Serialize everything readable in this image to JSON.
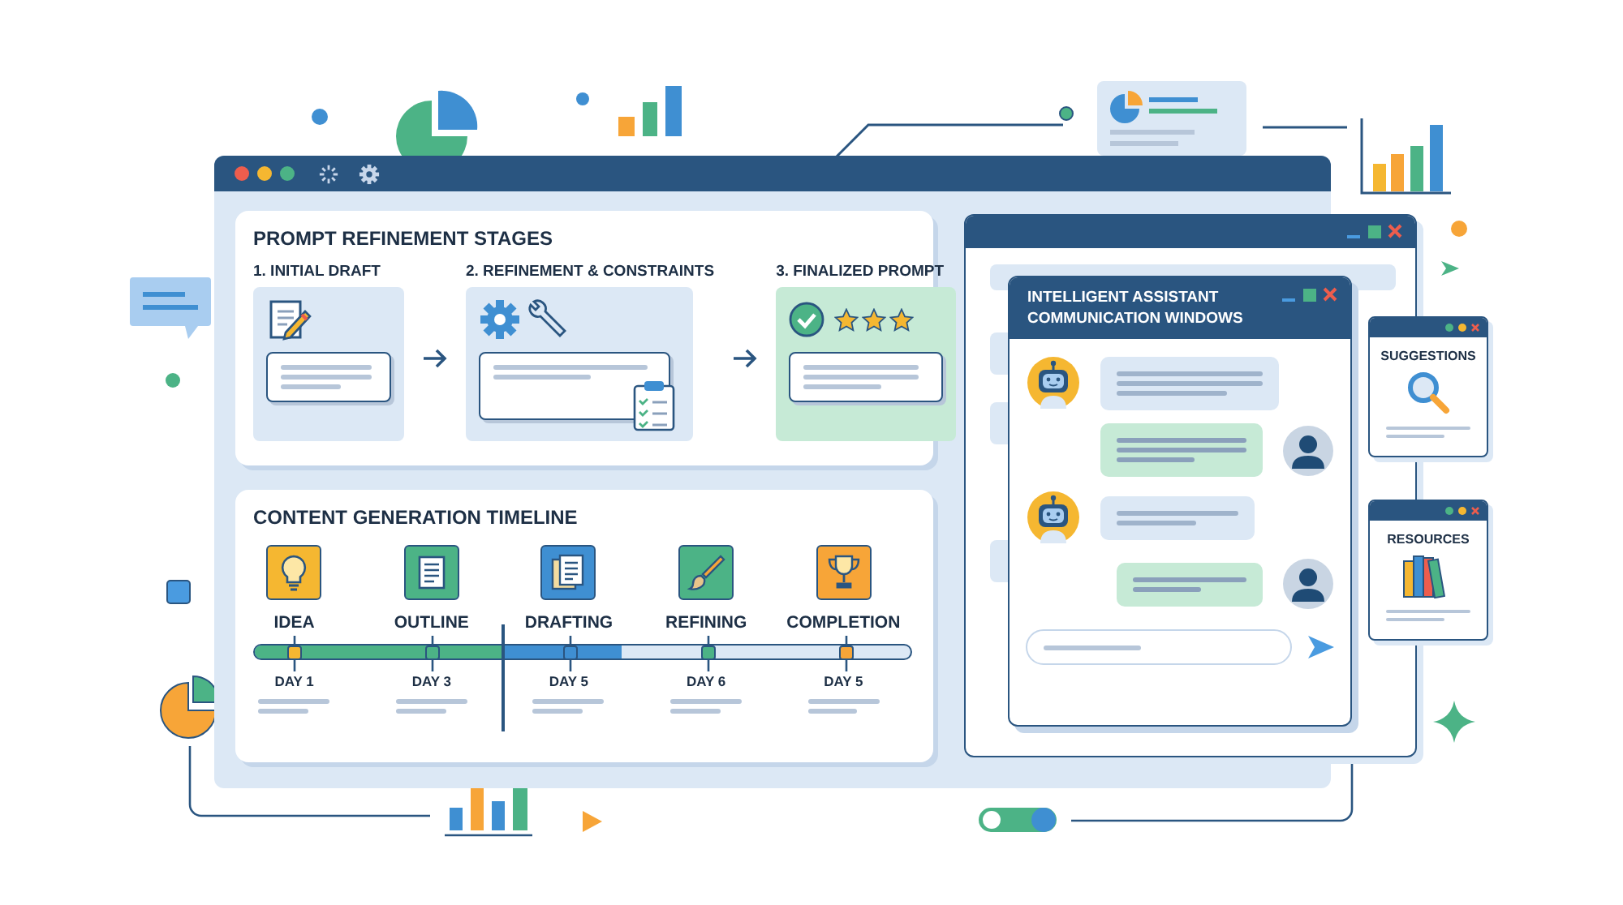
{
  "stages": {
    "title": "PROMPT REFINEMENT STAGES",
    "items": [
      {
        "label": "1. INITIAL DRAFT",
        "kind": "draft"
      },
      {
        "label": "2. REFINEMENT & CONSTRAINTS",
        "kind": "refine"
      },
      {
        "label": "3. FINALIZED PROMPT",
        "kind": "final",
        "stars": 3
      }
    ]
  },
  "timeline": {
    "title": "CONTENT GENERATION TIMELINE",
    "progress": [
      {
        "color": "#3f8fd2",
        "level": 0.56
      },
      {
        "color": "#4cb386",
        "level": 0.38
      }
    ],
    "milestones": [
      {
        "label": "IDEA",
        "day": "DAY 1",
        "kind": "idea",
        "color": "#f5b731"
      },
      {
        "label": "OUTLINE",
        "day": "DAY 3",
        "kind": "outline",
        "color": "#4cb386"
      },
      {
        "label": "DRAFTING",
        "day": "DAY 5",
        "kind": "drafting",
        "color": "#3f8fd2"
      },
      {
        "label": "REFINING",
        "day": "DAY 6",
        "kind": "refining",
        "color": "#4cb386"
      },
      {
        "label": "COMPLETION",
        "day": "DAY 5",
        "kind": "completion",
        "color": "#f7a538"
      }
    ]
  },
  "assistant": {
    "title": "INTELLIGENT ASSISTANT COMMUNICATION WINDOWS",
    "messages": [
      {
        "kind": "bot"
      },
      {
        "kind": "user"
      },
      {
        "kind": "bot"
      },
      {
        "kind": "user"
      }
    ]
  },
  "panels": [
    {
      "title": "SUGGESTIONS",
      "kind": "search"
    },
    {
      "title": "RESOURCES",
      "kind": "books"
    }
  ]
}
